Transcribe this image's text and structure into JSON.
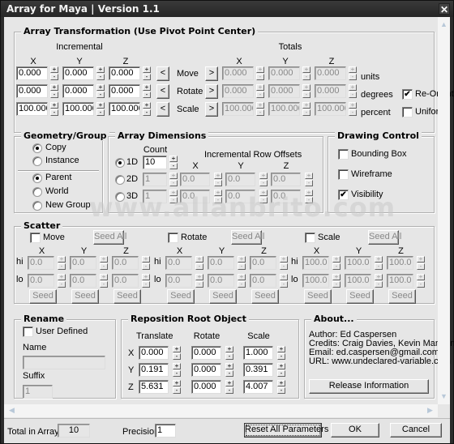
{
  "window": {
    "title": "Array for Maya | Version 1.1",
    "close_icon": "close-x"
  },
  "array_transformation": {
    "title": "Array Transformation (Use Pivot Point Center)",
    "incremental_label": "Incremental",
    "totals_label": "Totals",
    "axis_labels": [
      "X",
      "Y",
      "Z"
    ],
    "rows": [
      {
        "label": "Move",
        "incremental": [
          "0.000",
          "0.000",
          "0.000"
        ],
        "totals": [
          "0.000",
          "0.000",
          "0.000"
        ],
        "unit": "units",
        "left_button": "<",
        "right_button": ">"
      },
      {
        "label": "Rotate",
        "incremental": [
          "0.000",
          "0.000",
          "0.000"
        ],
        "totals": [
          "0.000",
          "0.000",
          "0.000"
        ],
        "unit": "degrees",
        "left_button": "<",
        "right_button": ">"
      },
      {
        "label": "Scale",
        "incremental": [
          "100.000",
          "100.000",
          "100.000"
        ],
        "totals": [
          "100.000",
          "100.000",
          "100.000"
        ],
        "unit": "percent",
        "left_button": "<",
        "right_button": ">"
      }
    ],
    "reorient": {
      "label": "Re-Orient",
      "checked": true
    },
    "uniform": {
      "label": "Uniform",
      "checked": false
    }
  },
  "geometry_group": {
    "title": "Geometry/Group",
    "type_options": [
      {
        "label": "Copy",
        "selected": true
      },
      {
        "label": "Instance",
        "selected": false
      }
    ],
    "parent_options": [
      {
        "label": "Parent",
        "selected": true
      },
      {
        "label": "World",
        "selected": false
      },
      {
        "label": "New Group",
        "selected": false
      }
    ]
  },
  "array_dimensions": {
    "title": "Array Dimensions",
    "count_label": "Count",
    "offsets_label": "Incremental Row Offsets",
    "axis_labels": [
      "X",
      "Y",
      "Z"
    ],
    "rows": [
      {
        "label": "1D",
        "selected": true,
        "count": "10",
        "offsets": null
      },
      {
        "label": "2D",
        "selected": false,
        "count": "1",
        "offsets": [
          "0.0",
          "0.0",
          "0.0"
        ]
      },
      {
        "label": "3D",
        "selected": false,
        "count": "1",
        "offsets": [
          "0.0",
          "0.0",
          "0.0"
        ]
      }
    ]
  },
  "drawing_control": {
    "title": "Drawing Control",
    "options": [
      {
        "label": "Bounding Box",
        "checked": false
      },
      {
        "label": "Wireframe",
        "checked": false
      },
      {
        "label": "Visibility",
        "checked": true
      }
    ]
  },
  "scatter": {
    "title": "Scatter",
    "hi_label": "hi",
    "lo_label": "lo",
    "axis_labels": [
      "X",
      "Y",
      "Z"
    ],
    "seed_all_label": "Seed All",
    "seed_label": "Seed",
    "sections": [
      {
        "label": "Move",
        "checked": false,
        "hi": [
          "0.0",
          "0.0",
          "0.0"
        ],
        "lo": [
          "0.0",
          "0.0",
          "0.0"
        ]
      },
      {
        "label": "Rotate",
        "checked": false,
        "hi": [
          "0.0",
          "0.0",
          "0.0"
        ],
        "lo": [
          "0.0",
          "0.0",
          "0.0"
        ]
      },
      {
        "label": "Scale",
        "checked": false,
        "hi": [
          "100.0",
          "100.0",
          "100.0"
        ],
        "lo": [
          "100.0",
          "100.0",
          "100.0"
        ]
      }
    ]
  },
  "rename": {
    "title": "Rename",
    "user_defined": {
      "label": "User Defined",
      "checked": false
    },
    "name_label": "Name",
    "name_value": "",
    "suffix_label": "Suffix",
    "suffix_value": "1"
  },
  "reposition": {
    "title": "Reposition Root Object",
    "column_labels": [
      "Translate",
      "Rotate",
      "Scale"
    ],
    "rows": [
      {
        "axis": "X",
        "translate": "0.000",
        "rotate": "0.000",
        "scale": "1.000"
      },
      {
        "axis": "Y",
        "translate": "0.191",
        "rotate": "0.000",
        "scale": "0.391"
      },
      {
        "axis": "Z",
        "translate": "5.631",
        "rotate": "0.000",
        "scale": "4.007"
      }
    ]
  },
  "about": {
    "title": "About...",
    "lines": [
      "Author: Ed Caspersen",
      "Credits: Craig Davies, Kevin Mannens",
      "Email: ed.caspersen@gmail.com",
      "URL: www.undeclared-variable.com"
    ],
    "release_button": "Release Information"
  },
  "footer": {
    "total_label": "Total in Array:",
    "total_value": "10",
    "precision_label": "Precision:",
    "precision_value": "1",
    "reset_button": "Reset All Parameters",
    "ok_button": "OK",
    "cancel_button": "Cancel"
  },
  "watermark": "www.allanbrito.com",
  "spin": {
    "up": "+",
    "down": "-"
  },
  "check_glyph": "✔"
}
